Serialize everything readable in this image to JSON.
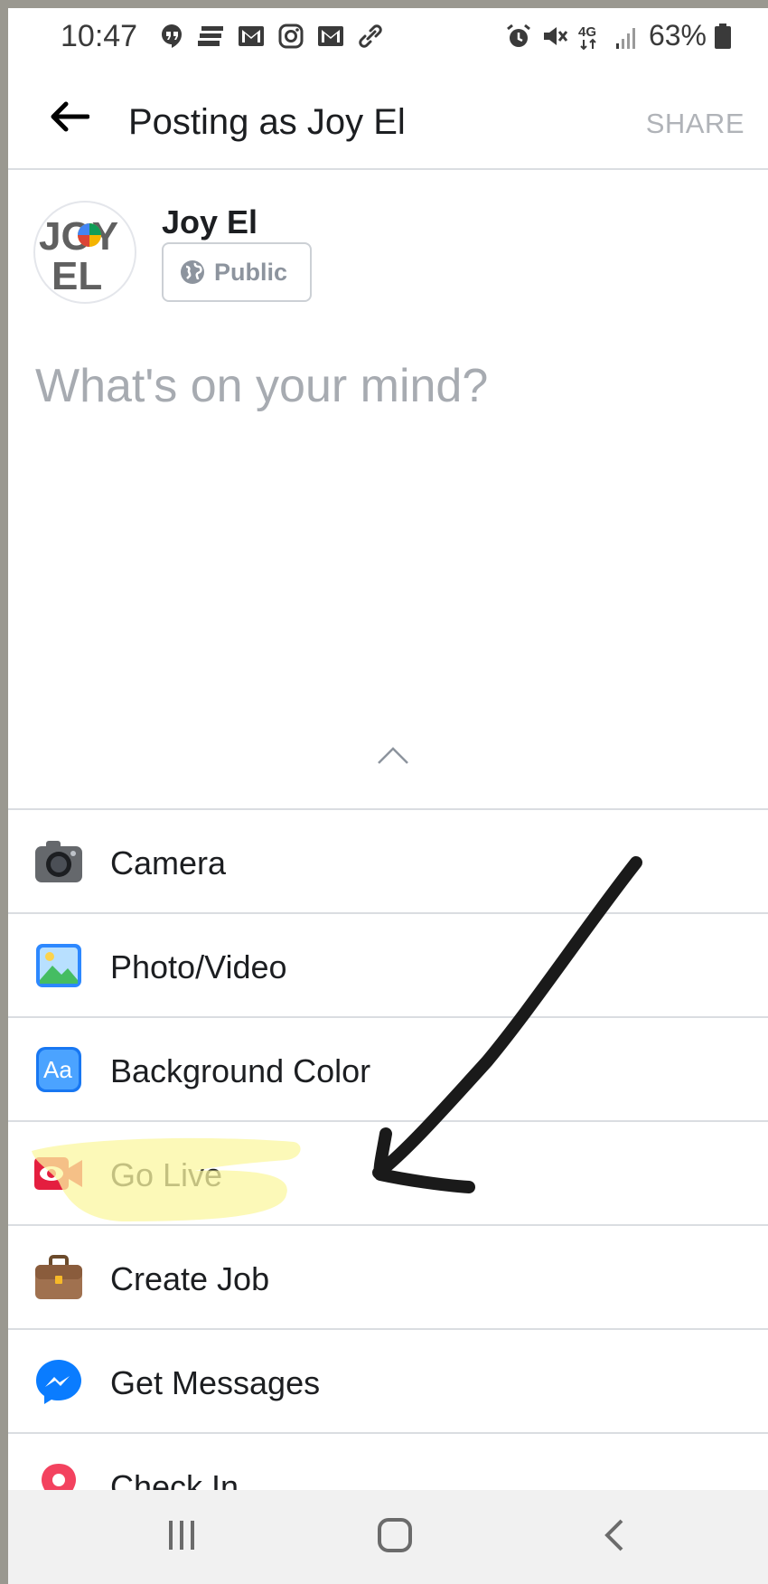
{
  "status_bar": {
    "time": "10:47",
    "battery_percent": "63%",
    "network": "4G"
  },
  "header": {
    "title": "Posting as Joy El",
    "share_label": "SHARE"
  },
  "composer": {
    "author_name": "Joy El",
    "avatar_text_top": "JOY",
    "avatar_text_bottom": "EL",
    "audience_label": "Public",
    "placeholder": "What's on your mind?"
  },
  "menu": {
    "items": [
      {
        "label": "Camera",
        "icon": "camera-icon"
      },
      {
        "label": "Photo/Video",
        "icon": "photo-video-icon"
      },
      {
        "label": "Background Color",
        "icon": "background-color-icon"
      },
      {
        "label": "Go Live",
        "icon": "go-live-icon"
      },
      {
        "label": "Create Job",
        "icon": "briefcase-icon"
      },
      {
        "label": "Get Messages",
        "icon": "messenger-icon"
      },
      {
        "label": "Check In",
        "icon": "location-pin-icon"
      }
    ]
  },
  "colors": {
    "accent_blue": "#1877f2",
    "live_red": "#e41e3f",
    "highlight_yellow": "#fbf7a0",
    "annotation_black": "#1a1a1a"
  }
}
